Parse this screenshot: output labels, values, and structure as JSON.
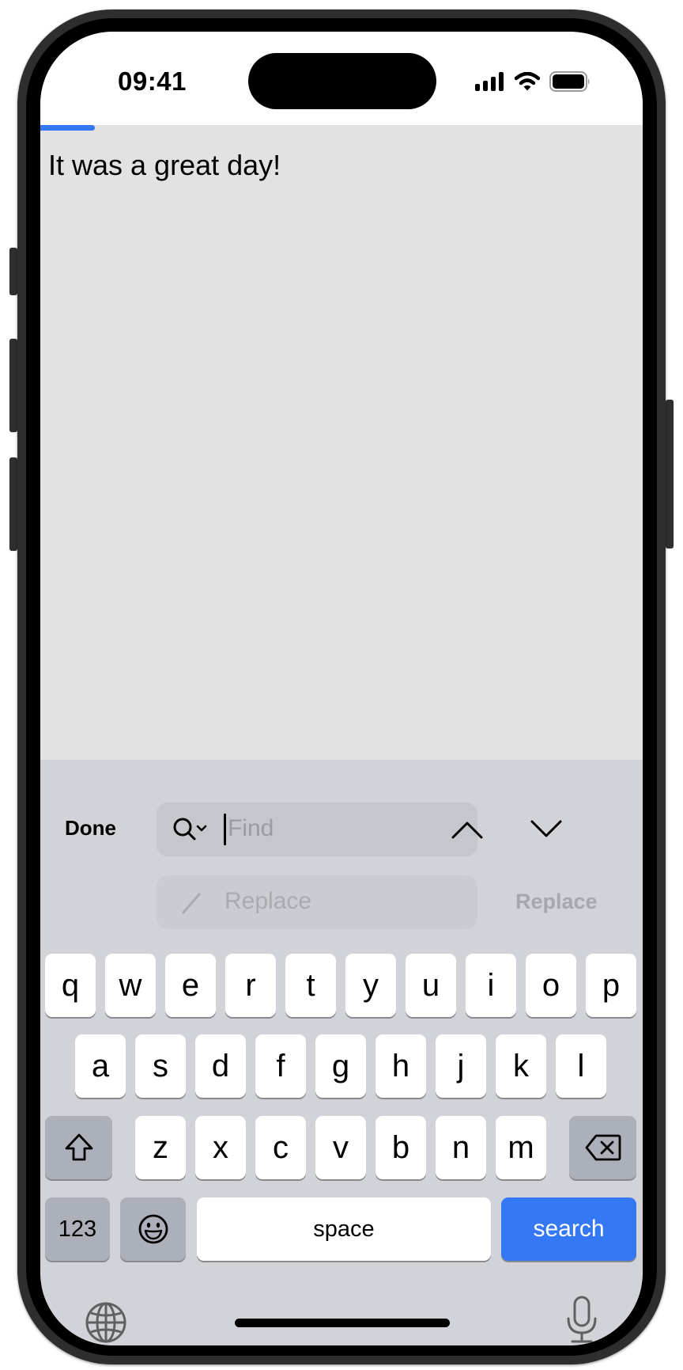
{
  "status_bar": {
    "time": "09:41",
    "icons": [
      "cellular-signal-icon",
      "wifi-icon",
      "battery-icon"
    ]
  },
  "document": {
    "text": "It was a great day!",
    "load_progress": 0.09
  },
  "find_bar": {
    "done_label": "Done",
    "find_value": "",
    "find_placeholder": "Find",
    "find_icon": "search-options-icon",
    "previous_icon": "chevron-up-icon",
    "next_icon": "chevron-down-icon",
    "replace_value": "",
    "replace_placeholder": "Replace",
    "replace_icon": "pencil-icon",
    "replace_button_label": "Replace"
  },
  "keyboard": {
    "row1": [
      "q",
      "w",
      "e",
      "r",
      "t",
      "y",
      "u",
      "i",
      "o",
      "p"
    ],
    "row2": [
      "a",
      "s",
      "d",
      "f",
      "g",
      "h",
      "j",
      "k",
      "l"
    ],
    "row3": [
      "z",
      "x",
      "c",
      "v",
      "b",
      "n",
      "m"
    ],
    "shift_icon": "shift-icon",
    "delete_icon": "delete-icon",
    "numbers_label": "123",
    "emoji_icon": "emoji-icon",
    "space_label": "space",
    "return_label": "search",
    "globe_icon": "globe-icon",
    "mic_icon": "microphone-icon"
  },
  "colors": {
    "accent": "#3478f6",
    "content_bg": "#e2e2e2",
    "keyboard_bg": "#d1d3d8"
  }
}
